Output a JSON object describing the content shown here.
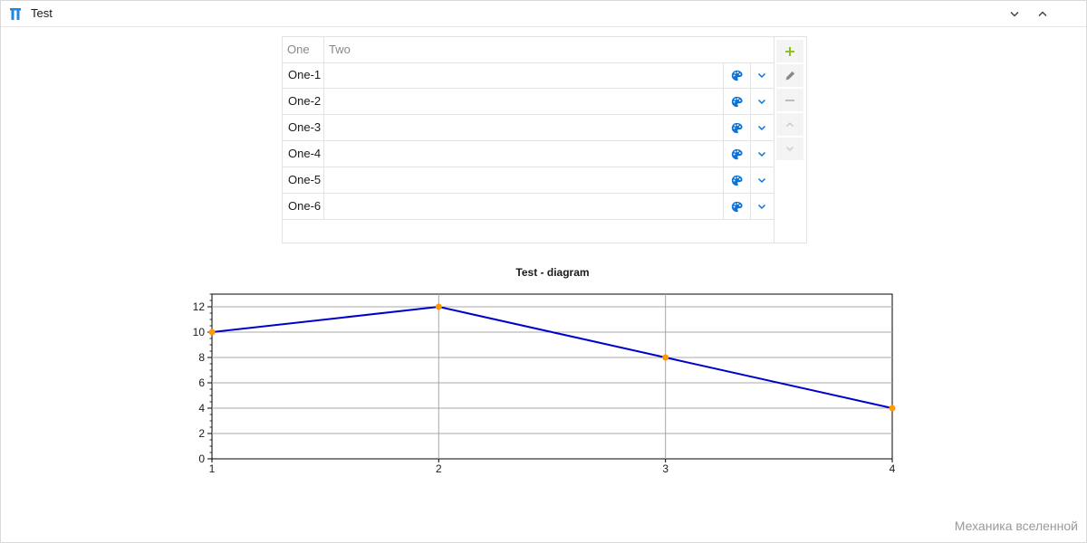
{
  "window": {
    "title": "Test",
    "controls": [
      "minimize-icon",
      "maximize-icon"
    ]
  },
  "grid": {
    "columns": [
      "One",
      "Two"
    ],
    "rows": [
      {
        "one": "One-1",
        "two": ""
      },
      {
        "one": "One-2",
        "two": ""
      },
      {
        "one": "One-3",
        "two": ""
      },
      {
        "one": "One-4",
        "two": ""
      },
      {
        "one": "One-5",
        "two": ""
      },
      {
        "one": "One-6",
        "two": ""
      }
    ],
    "row_icons": [
      "palette-icon",
      "chevron-down-icon"
    ]
  },
  "toolbar": {
    "buttons": [
      {
        "name": "add-button",
        "icon": "plus-icon",
        "color": "#8cc21f",
        "enabled": true
      },
      {
        "name": "edit-button",
        "icon": "pencil-icon",
        "color": "#8a8a8a",
        "enabled": true
      },
      {
        "name": "remove-button",
        "icon": "minus-icon",
        "color": "#bdbdbd",
        "enabled": false
      },
      {
        "name": "move-up-button",
        "icon": "chevron-up-icon",
        "color": "#c8c8c8",
        "enabled": false
      },
      {
        "name": "move-down-button",
        "icon": "chevron-down-icon",
        "color": "#c8c8c8",
        "enabled": false
      }
    ]
  },
  "colors": {
    "accent": "#0a74d8",
    "line": "#0000cc",
    "marker": "#ff9900",
    "grid": "#a8a8a8"
  },
  "chart_data": {
    "type": "line",
    "title": "Test - diagram",
    "x": [
      1,
      2,
      3,
      4
    ],
    "series": [
      {
        "values": [
          10,
          12,
          8,
          4
        ]
      }
    ],
    "xlim": [
      1,
      4
    ],
    "ylim": [
      0,
      13
    ],
    "xticks": [
      "1",
      "2",
      "3",
      "4"
    ],
    "yticks": [
      "0",
      "2",
      "4",
      "6",
      "8",
      "10",
      "12"
    ],
    "grid": true
  },
  "footer": {
    "watermark": "Механика вселенной"
  }
}
